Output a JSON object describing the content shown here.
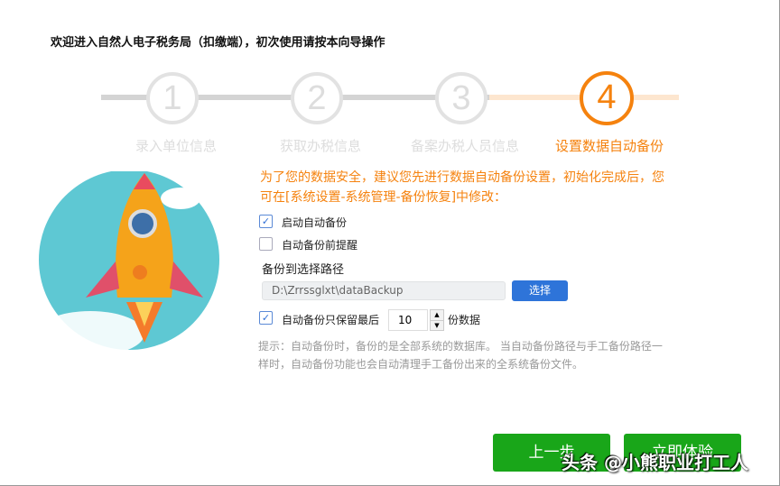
{
  "title": "欢迎进入自然人电子税务局（扣缴端），初次使用请按本向导操作",
  "steps": [
    {
      "num": "1",
      "label": "录入单位信息"
    },
    {
      "num": "2",
      "label": "获取办税信息"
    },
    {
      "num": "3",
      "label": "备案办税人员信息"
    },
    {
      "num": "4",
      "label": "设置数据自动备份"
    }
  ],
  "intro": "为了您的数据安全，建议您先进行数据自动备份设置，初始化完成后，您可在[系统设置-系统管理-备份恢复]中修改：",
  "enable_backup": {
    "label": "启动自动备份",
    "checked": true
  },
  "remind": {
    "label": "自动备份前提醒",
    "checked": false
  },
  "path_label": "备份到选择路径",
  "path_value": "D:\\Zrrssglxt\\dataBackup",
  "select_button": "选择",
  "keep": {
    "label": "自动备份只保留最后",
    "value": "10",
    "suffix": "份数据",
    "checked": true
  },
  "hint": "提示：自动备份时，备份的是全部系统的数据库。 当自动备份路径与手工备份路径一样时，自动备份功能也会自动清理手工备份出来的全系统备份文件。",
  "buttons": {
    "prev": "上一步",
    "start": "立即体验"
  },
  "watermark": "头条 @小熊职业打工人",
  "colors": {
    "accent": "#f5820e",
    "primary": "#2e74d9",
    "green": "#19a619"
  }
}
